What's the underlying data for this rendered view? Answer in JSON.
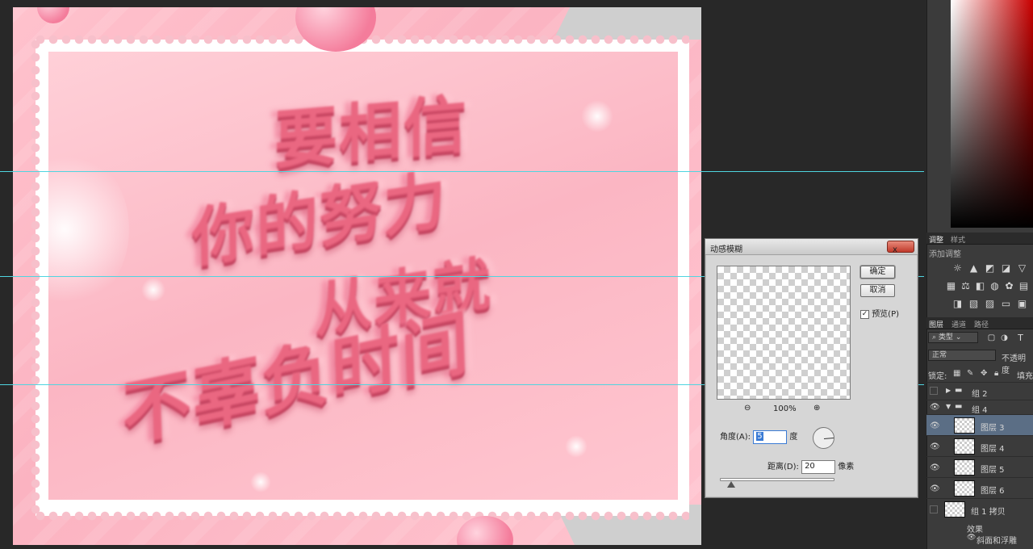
{
  "canvas": {
    "poster_lines": [
      "要相信",
      "你的努力",
      "从来就",
      "不辜负时间"
    ]
  },
  "dialog": {
    "title": "动感模糊",
    "close_label": "x",
    "ok_label": "确定",
    "cancel_label": "取消",
    "preview_label": "预览(P)",
    "preview_checked": true,
    "zoom_percent": "100%",
    "angle_label": "角度(A):",
    "angle_value": "5",
    "angle_unit": "度",
    "distance_label": "距离(D):",
    "distance_value": "20",
    "distance_unit": "像素",
    "distance_slider_fraction": 0.1
  },
  "panels": {
    "adjust_tabs": [
      "调整",
      "样式"
    ],
    "adjust_title": "添加调整",
    "layer_tabs": [
      "图层",
      "通道",
      "路径"
    ],
    "filter_kind": "类型",
    "blend_mode": "正常",
    "opacity_label": "不透明度",
    "lock_label": "锁定:",
    "fill_label": "填充",
    "layers": [
      {
        "name": "组 2",
        "kind": "group",
        "expanded": false,
        "visible": false
      },
      {
        "name": "组 4",
        "kind": "group",
        "expanded": true,
        "visible": true
      },
      {
        "name": "图层 3",
        "kind": "layer",
        "selected": true,
        "visible": true
      },
      {
        "name": "图层 4",
        "kind": "layer",
        "visible": true
      },
      {
        "name": "图层 5",
        "kind": "layer",
        "visible": true
      },
      {
        "name": "图层 6",
        "kind": "layer",
        "visible": true
      },
      {
        "name": "组 1 拷贝",
        "kind": "layer",
        "visible": false
      }
    ],
    "effects_label": "效果",
    "effect_item": "斜面和浮雕"
  },
  "colors": {
    "workspace": "#282828",
    "canvas_pink": "#fbb6c3",
    "title_pink": "#ea6781",
    "guide_cyan": "#4fd5e0",
    "selected_layer": "#5b6e85"
  }
}
